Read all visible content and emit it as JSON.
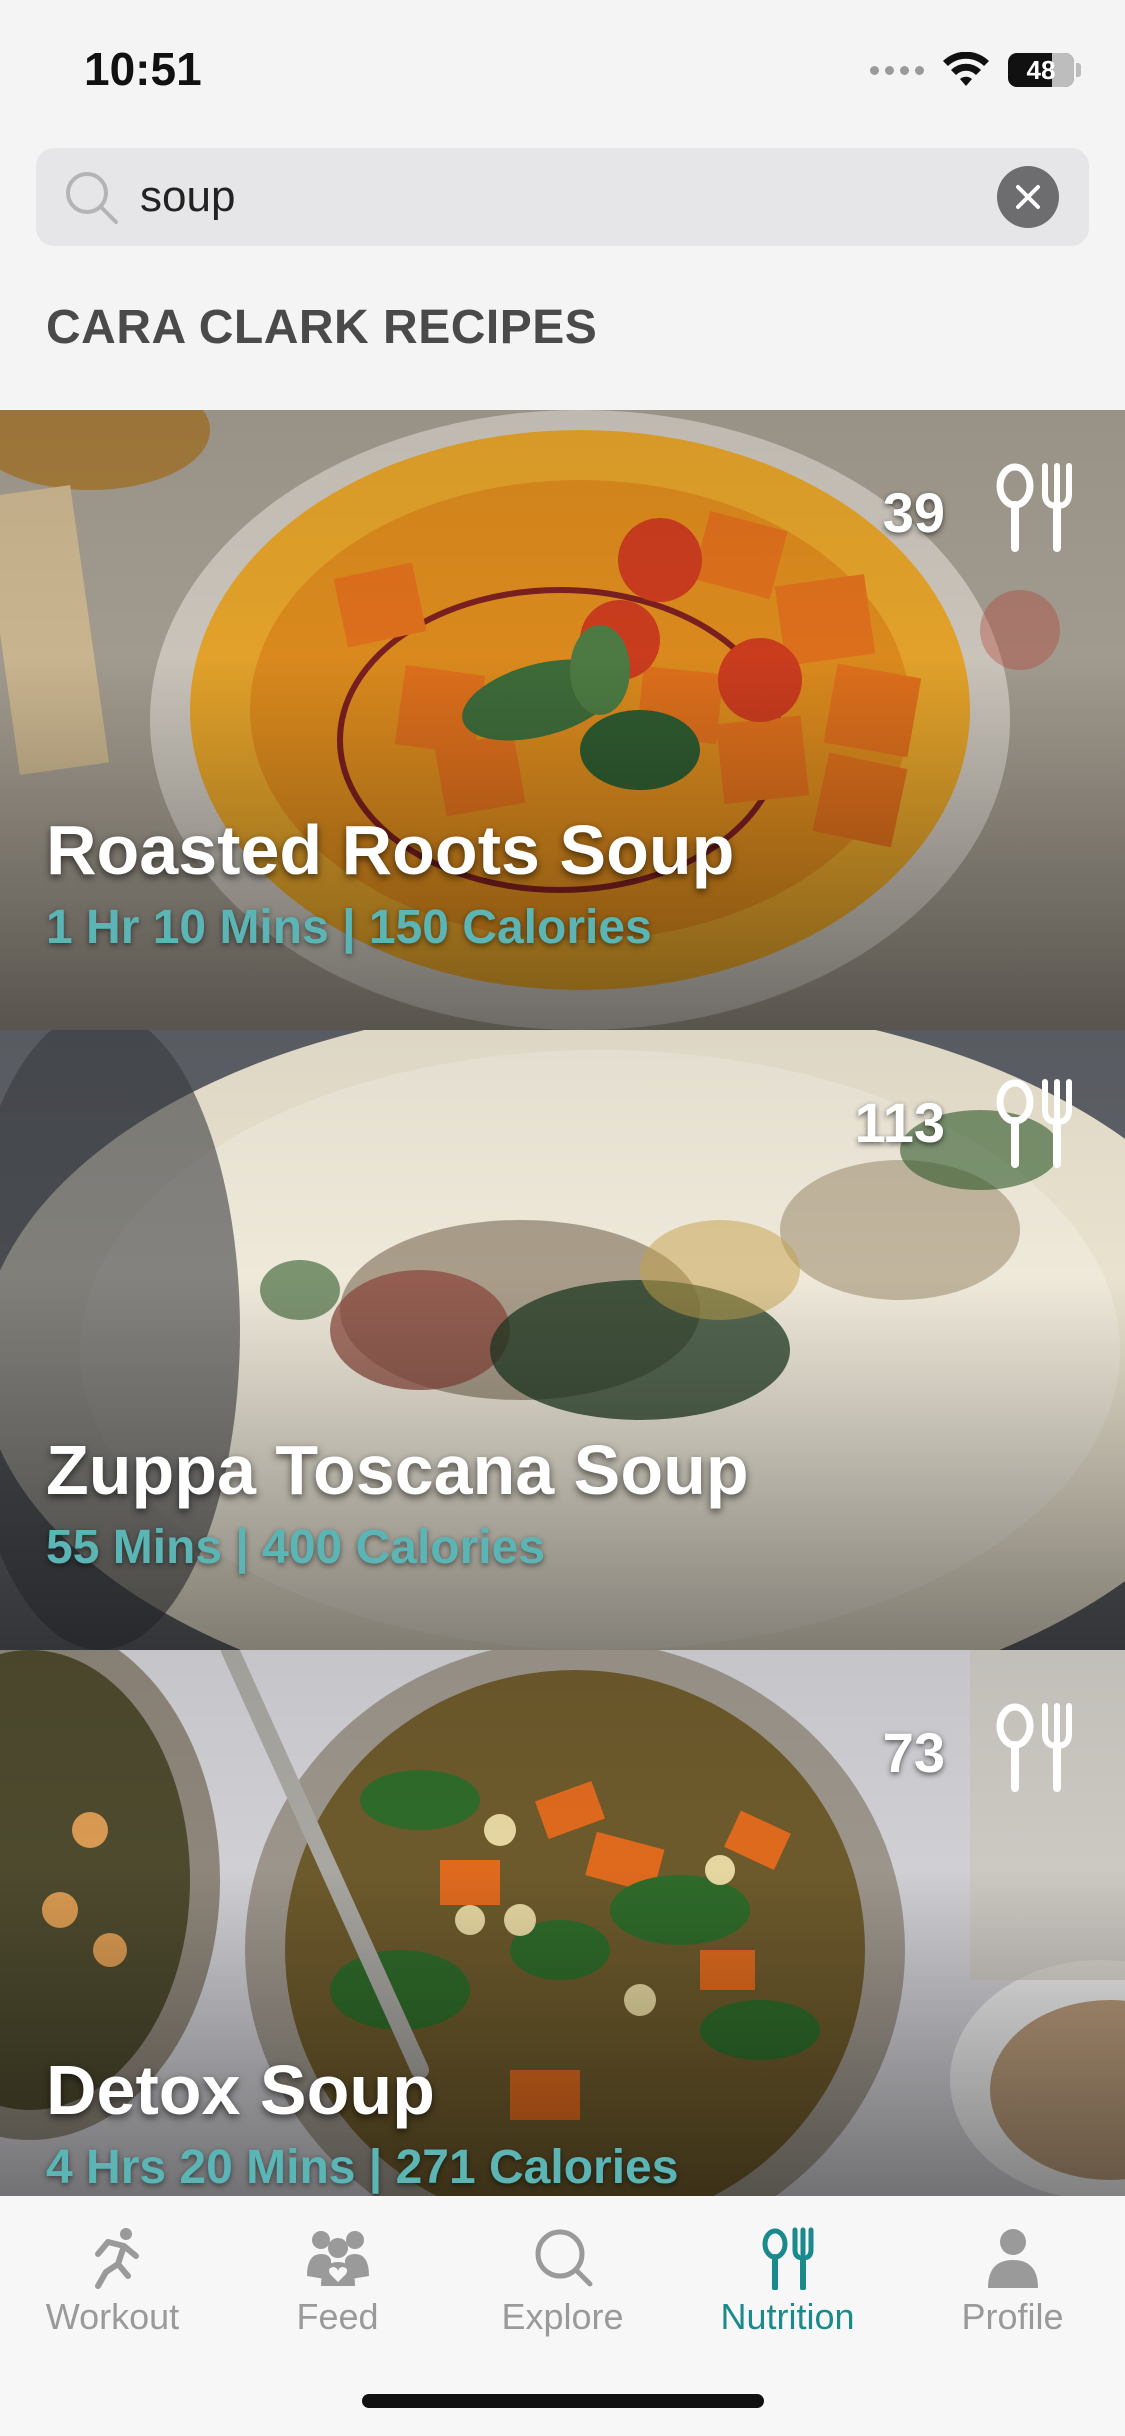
{
  "status_bar": {
    "time": "10:51",
    "battery": "48"
  },
  "search": {
    "value": "soup",
    "placeholder": ""
  },
  "section": {
    "title": "CARA CLARK RECIPES"
  },
  "recipes": [
    {
      "title": "Roasted Roots Soup",
      "meta": "1 Hr 10 Mins | 150 Calories",
      "count": "39"
    },
    {
      "title": "Zuppa Toscana Soup",
      "meta": "55 Mins | 400 Calories",
      "count": "113"
    },
    {
      "title": "Detox Soup",
      "meta": "4 Hrs 20 Mins | 271 Calories",
      "count": "73"
    }
  ],
  "tabs": [
    {
      "label": "Workout",
      "icon": "runner-icon"
    },
    {
      "label": "Feed",
      "icon": "group-icon"
    },
    {
      "label": "Explore",
      "icon": "search-icon"
    },
    {
      "label": "Nutrition",
      "icon": "utensils-icon"
    },
    {
      "label": "Profile",
      "icon": "person-icon"
    }
  ],
  "colors": {
    "accent": "#1a8a8c",
    "meta_text": "#5bb5b5",
    "inactive_tab": "#9a9a9a"
  }
}
